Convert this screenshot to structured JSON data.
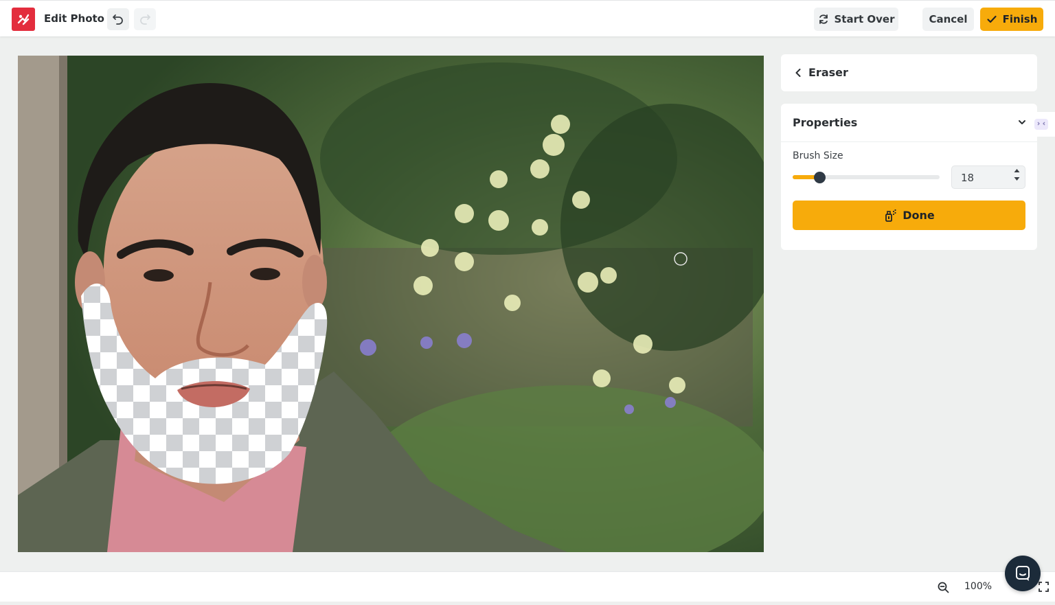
{
  "app": {
    "title": "Edit Photo"
  },
  "toolbar": {
    "start_over_label": "Start Over",
    "cancel_label": "Cancel",
    "finish_label": "Finish"
  },
  "eraser_panel": {
    "title": "Eraser"
  },
  "properties": {
    "title": "Properties",
    "brush_size_label": "Brush Size",
    "brush_size_value": "18",
    "brush_size_fraction": 0.18,
    "done_label": "Done"
  },
  "footer": {
    "zoom_value": "100%"
  },
  "colors": {
    "accent": "#f7ab0b",
    "logo_red": "#e32d3d",
    "slider_thumb": "#2f3a45",
    "chat_bubble": "#1c2b3a"
  },
  "icons": {
    "logo": "photo-edit-logo-icon",
    "undo": "undo-icon",
    "redo": "redo-icon",
    "start_over": "refresh-icon",
    "finish": "check-icon",
    "back": "chevron-left-icon",
    "collapse": "chevron-down-icon",
    "done": "spray-bottle-icon",
    "zoom": "zoom-out-icon",
    "fullscreen": "fullscreen-icon",
    "chat": "chat-icon"
  }
}
